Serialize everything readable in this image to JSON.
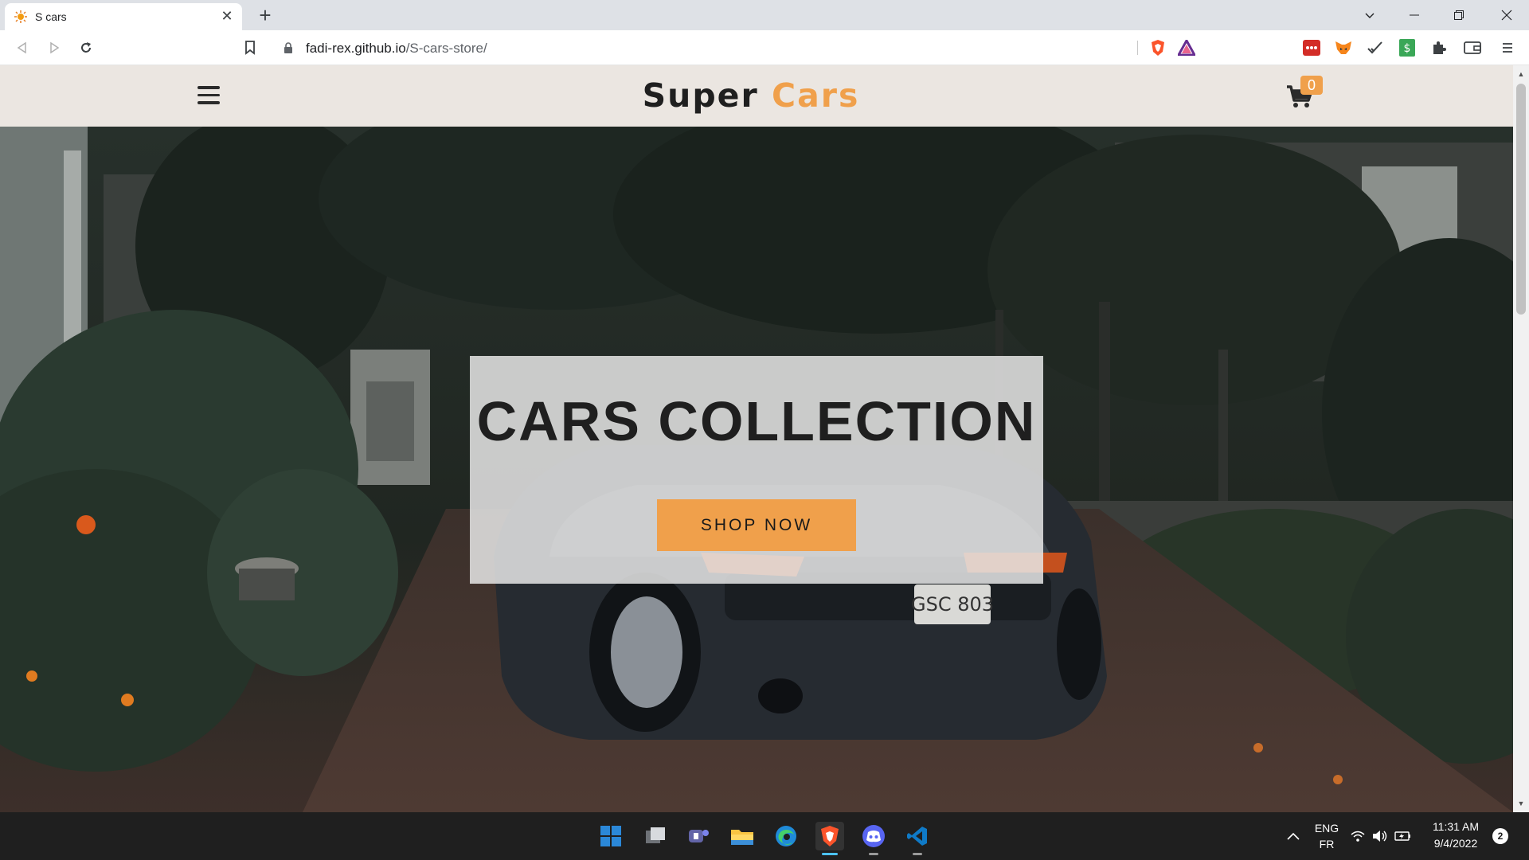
{
  "browser": {
    "tab": {
      "title": "S cars",
      "close_label": "✕"
    },
    "new_tab_label": "+",
    "url": {
      "host": "fadi-rex.github.io",
      "path": "/S-cars-store/"
    }
  },
  "site": {
    "brand": {
      "first": "Super ",
      "second": "Cars"
    },
    "cart_count": "0",
    "hero": {
      "title": "CARS COLLECTION",
      "button": "SHOP NOW"
    },
    "colors": {
      "accent": "#f0a04b",
      "header_bg": "#ebe6e1"
    }
  },
  "taskbar": {
    "language": {
      "primary": "ENG",
      "secondary": "FR"
    },
    "time": "11:31 AM",
    "date": "9/4/2022",
    "notification_count": "2",
    "apps": [
      "start-icon",
      "task-view-icon",
      "teams-icon",
      "file-explorer-icon",
      "edge-icon",
      "brave-icon",
      "discord-icon",
      "vscode-icon"
    ]
  }
}
